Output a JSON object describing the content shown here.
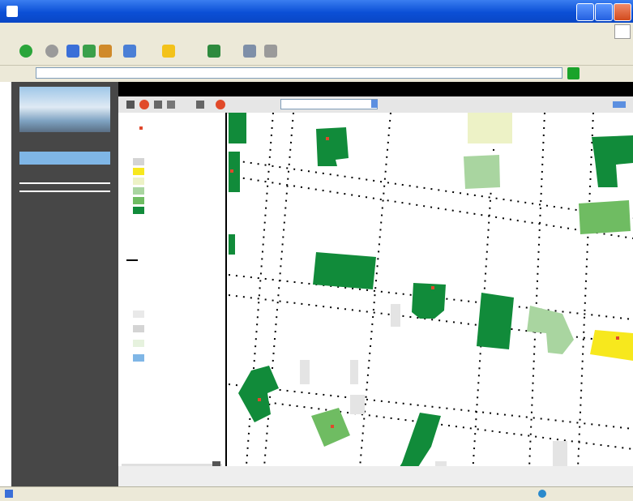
{
  "window": {
    "title": "",
    "minimize_icon": "minimize-icon",
    "maximize_icon": "maximize-icon",
    "close_icon": "close-icon"
  },
  "menubar": {
    "items": []
  },
  "toolbar": {
    "icons": [
      "back-icon",
      "forward-icon",
      "stop-icon",
      "refresh-icon",
      "home-icon",
      "search-icon",
      "favorites-icon",
      "history-icon",
      "mail-icon",
      "print-icon"
    ]
  },
  "address": {
    "label": "",
    "url": "",
    "go_icon": "go-arrow-icon"
  },
  "app_bar": {
    "title": ""
  },
  "app_toolbar": {
    "tools": [
      "pan-icon",
      "zoom-in-icon",
      "zoom-out-icon",
      "identify-icon",
      "measure-icon",
      "clear-icon"
    ],
    "scale_select": ""
  },
  "sidebar": {
    "header_text": "",
    "nav_selected": "",
    "links": [
      "",
      ""
    ]
  },
  "legend": {
    "groups": [
      {
        "title": "",
        "items": [
          ""
        ]
      },
      {
        "title": "",
        "items": [
          "",
          "",
          "",
          "",
          "",
          ""
        ]
      },
      {
        "title": "",
        "items": [
          ""
        ]
      },
      {
        "title": "",
        "items": [
          "",
          "",
          "",
          "",
          ""
        ]
      }
    ],
    "colors": {
      "dark_green": "#118b3a",
      "mid_green": "#6fbc62",
      "light_green": "#a9d5a0",
      "yellow": "#f7e81d",
      "pale_yellow": "#edf2c6",
      "gray": "#d4d4d4",
      "light_gray": "#e9e9e9",
      "blue": "#7fb6e6",
      "red_marker": "#e0482c"
    }
  },
  "status": {
    "left": "",
    "right": ""
  },
  "accent": {
    "titlebar": "#0b4fd6",
    "sidebar": "#474747",
    "sidebar_highlight": "#7fb6e6"
  }
}
